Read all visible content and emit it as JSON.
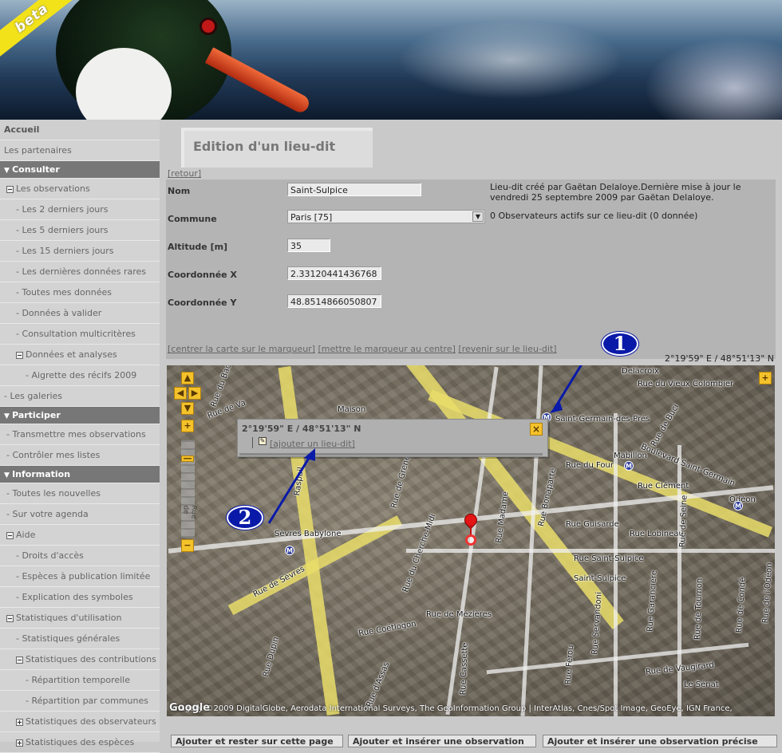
{
  "banner": {
    "ribbon_text": "beta"
  },
  "sidebar": {
    "items": [
      {
        "label": "Accueil",
        "kind": "top"
      },
      {
        "label": "Les partenaires",
        "kind": "plain"
      },
      {
        "label": "Consulter",
        "kind": "header"
      },
      {
        "label": "Les observations",
        "kind": "tree",
        "indent": 1,
        "box": "minus"
      },
      {
        "label": "- Les 2 derniers jours",
        "kind": "leaf",
        "indent": 2
      },
      {
        "label": "- Les 5 derniers jours",
        "kind": "leaf",
        "indent": 2
      },
      {
        "label": "- Les 15 derniers jours",
        "kind": "leaf",
        "indent": 2
      },
      {
        "label": "- Les dernières données rares",
        "kind": "leaf",
        "indent": 2
      },
      {
        "label": "- Toutes mes données",
        "kind": "leaf",
        "indent": 2
      },
      {
        "label": "- Données à valider",
        "kind": "leaf",
        "indent": 2
      },
      {
        "label": "- Consultation multicritères",
        "kind": "leaf",
        "indent": 2
      },
      {
        "label": "Données et analyses",
        "kind": "tree",
        "indent": 2,
        "box": "minus"
      },
      {
        "label": "- Aigrette des récifs 2009",
        "kind": "leaf",
        "indent": 3
      },
      {
        "label": "- Les galeries",
        "kind": "plain"
      },
      {
        "label": "Participer",
        "kind": "header"
      },
      {
        "label": "- Transmettre mes observations",
        "kind": "leaf",
        "indent": 1
      },
      {
        "label": "- Contrôler mes listes",
        "kind": "leaf",
        "indent": 1
      },
      {
        "label": "Information",
        "kind": "header"
      },
      {
        "label": "- Toutes les nouvelles",
        "kind": "leaf",
        "indent": 1
      },
      {
        "label": "- Sur votre agenda",
        "kind": "leaf",
        "indent": 1
      },
      {
        "label": "Aide",
        "kind": "tree",
        "indent": 1,
        "box": "minus"
      },
      {
        "label": "- Droits d'accès",
        "kind": "leaf",
        "indent": 2
      },
      {
        "label": "- Espèces à publication limitée",
        "kind": "leaf",
        "indent": 2
      },
      {
        "label": "- Explication des symboles",
        "kind": "leaf",
        "indent": 2
      },
      {
        "label": "Statistiques d'utilisation",
        "kind": "tree",
        "indent": 1,
        "box": "minus"
      },
      {
        "label": "- Statistiques générales",
        "kind": "leaf",
        "indent": 2
      },
      {
        "label": "Statistiques des contributions",
        "kind": "tree",
        "indent": 2,
        "box": "minus"
      },
      {
        "label": "- Répartition temporelle",
        "kind": "leaf",
        "indent": 3
      },
      {
        "label": "- Répartition par communes",
        "kind": "leaf",
        "indent": 3
      },
      {
        "label": "Statistiques des observateurs",
        "kind": "tree",
        "indent": 2,
        "box": "plus"
      },
      {
        "label": "Statistiques des espèces",
        "kind": "tree",
        "indent": 2,
        "box": "plus"
      }
    ]
  },
  "page": {
    "title": "Edition d'un lieu-dit",
    "retour": "[retour]"
  },
  "form": {
    "nom_label": "Nom",
    "nom_value": "Saint-Sulpice",
    "commune_label": "Commune",
    "commune_value": "Paris [75]",
    "altitude_label": "Altitude [m]",
    "altitude_value": "35",
    "x_label": "Coordonnée X",
    "x_value": "2.33120441436768",
    "y_label": "Coordonnée Y",
    "y_value": "48.8514866050807",
    "info_created": "Lieu-dit créé par Gaëtan Delaloye.Dernière mise à jour le vendredi 25 septembre 2009 par Gaëtan Delaloye.",
    "info_observers": "0 Observateurs actifs sur ce lieu-dit (0 donnée)"
  },
  "map_links": {
    "center_map": "[centrer la carte sur le marqueur]",
    "marker_center": "[mettre le marqueur au centre]",
    "back_lieu": "[revenir sur le lieu-dit]"
  },
  "map": {
    "coords_readout": "2°19'59\" E / 48°51'13\" N",
    "popup_coords": "2°19'59\" E / 48°51'13\" N",
    "popup_link": "[ajouter un lieu-dit]",
    "marker_label": "Saint-Sulpice",
    "copyright": "Imagery ©2009 DigitalGlobe, Aerodata International Surveys, The GeoInformation Group | InterAtlas, Cnes/Spot Image, GeoEye, IGN France,",
    "google_logo": "Google",
    "scale_label": "Rue de",
    "streets": {
      "s1": "Boulevard Saint-Germain",
      "s2": "Rue du Four",
      "s3": "Rue Clément",
      "s4": "Rue Lobineau",
      "s5": "Rue Guisarde",
      "s6": "Rue Saint-Sulpice",
      "s7": "Rue de Sèvres",
      "s8": "Rue de Mézières",
      "s9": "Rue Coëtlogon",
      "s10": "Rue de Vaugirard",
      "s11": "Rue Bonaparte",
      "s12": "Rue Madame",
      "s13": "Rue Cassette",
      "s14": "Rue de Grenelle",
      "s15": "Rue du Cherche-Midi",
      "s16": "Rue de Buci",
      "s17": "Mabillon",
      "s18": "Odéon",
      "s19": "Saint-Germain-des-Prés",
      "s20": "Sèvres Babylone",
      "s21": "Delacroix",
      "s22": "Le Sénat",
      "s23": "Rue de Seine",
      "s24": "Rue de Tournon",
      "s25": "Rue Garancière",
      "s26": "Rue Servandoni",
      "s27": "Rue Férou",
      "s28": "Saint-Sulpice",
      "s29": "Rue Dupin",
      "s30": "Rue d'Assas",
      "s31": "Rue de Condé",
      "s32": "Rue de l'Odéon",
      "s33": "Rue du Vieux Colombier",
      "s34": "Raspail",
      "s35": "Maison",
      "s36": "Rue du Bac",
      "s37": "Rue de Va"
    }
  },
  "annotations": {
    "a1": "1",
    "a2": "2"
  },
  "bottom": {
    "b1": "Ajouter et rester sur cette page",
    "b2": "Ajouter et insérer une observation",
    "b3": "Ajouter et insérer une observation précise"
  },
  "colors": {
    "sidebar_header": "#777777",
    "zoom_button": "#f4c22a",
    "annotation": "#0a1aa8",
    "marker": "#e31515"
  }
}
